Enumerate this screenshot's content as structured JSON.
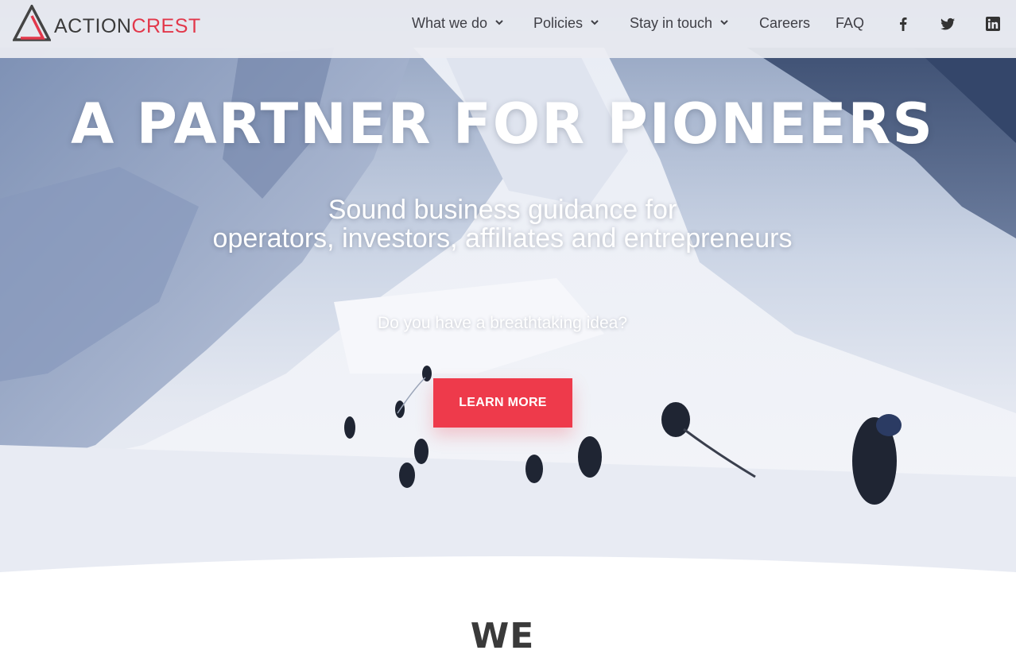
{
  "brand": {
    "name_part1": "ACTION",
    "name_part2": "CREST",
    "accent_color": "#e2384b"
  },
  "nav": {
    "items": [
      {
        "label": "What we do",
        "has_dropdown": true
      },
      {
        "label": "Policies",
        "has_dropdown": true
      },
      {
        "label": "Stay in touch",
        "has_dropdown": true
      },
      {
        "label": "Careers",
        "has_dropdown": false
      },
      {
        "label": "FAQ",
        "has_dropdown": false
      }
    ],
    "social": [
      "facebook-icon",
      "twitter-icon",
      "linkedin-icon"
    ]
  },
  "hero": {
    "title": "A PARTNER FOR PIONEERS",
    "subtitle_line1": "Sound business guidance for",
    "subtitle_line2": "operators, investors, affiliates and entrepreneurs",
    "question": "Do you have a breathtaking idea?",
    "cta_label": "LEARN MORE",
    "cta_color": "#ee3a4b"
  },
  "section": {
    "heading": "WE"
  }
}
